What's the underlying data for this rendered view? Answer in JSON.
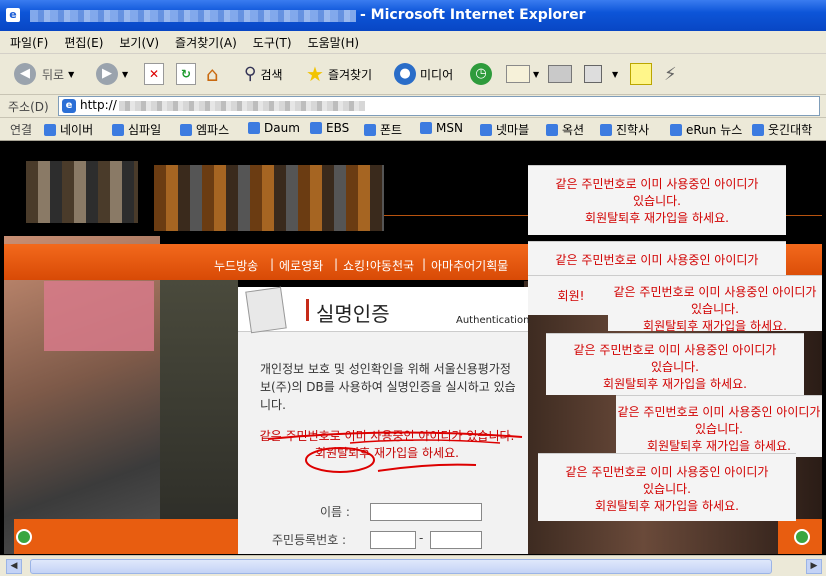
{
  "window": {
    "title": "- Microsoft Internet Explorer"
  },
  "menu": [
    "파일(F)",
    "편집(E)",
    "보기(V)",
    "즐겨찾기(A)",
    "도구(T)",
    "도움말(H)"
  ],
  "toolbar": {
    "back": "뒤로",
    "search": "검색",
    "favorites": "즐겨찾기",
    "media": "미디어"
  },
  "address": {
    "label": "주소(D)",
    "url": "http://"
  },
  "links": {
    "label": "연결",
    "items": [
      "네이버",
      "심파일",
      "엠파스",
      "Daum",
      "EBS",
      "폰트",
      "MSN",
      "넷마블",
      "옥션",
      "진학사",
      "eRun 뉴스",
      "웃긴대학"
    ]
  },
  "nav": [
    "누드방송",
    "에로영화",
    "쇼킹!야동천국",
    "아마추어기획물"
  ],
  "panel": {
    "title": "실명인증",
    "subtitle": "Authentication",
    "desc": "개인정보 보호 및 성인확인을 위해 서울신용평가정보(주)의 DB를 사용하여 실명인증을 실시하고 있습니다.",
    "msg1": "같은 주민번호로 이미 사용중인 아이디가 있습니다.",
    "msg2": "회원탈퇴후 재가입을 하세요.",
    "name_label": "이름 :",
    "rrn_label": "주민등록번호 :",
    "dash": "-"
  },
  "popup": {
    "line1": "같은 주민번호로 이미 사용중인 아이디가",
    "line2": "있습니다.",
    "line3": "회원탈퇴후 재가입을 하세요.",
    "partial": "회원!"
  }
}
